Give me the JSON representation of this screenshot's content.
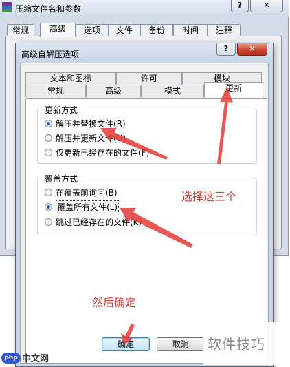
{
  "background_window": {
    "title": "压缩文件名和参数",
    "help_glyph": "?",
    "close_glyph": "✕",
    "tabs": [
      "常规",
      "高级",
      "选项",
      "文件",
      "备份",
      "时间",
      "注释"
    ],
    "selected_tab": "高级"
  },
  "dialog": {
    "title": "高级自解压选项",
    "help_glyph": "?",
    "close_glyph": "✕",
    "tabs_back_row": [
      "文本和图标",
      "许可",
      "模块"
    ],
    "tabs_front_row": [
      "常规",
      "高级",
      "模式",
      "更新"
    ],
    "selected_tab": "更新",
    "update_group": {
      "label": "更新方式",
      "options": [
        "解压并替换文件(R)",
        "解压并更新文件(U)",
        "仅更新已经存在的文件(F)"
      ],
      "selected_index": 0
    },
    "overwrite_group": {
      "label": "覆盖方式",
      "options": [
        "在覆盖前询问(B)",
        "覆盖所有文件(L)",
        "跳过已经存在的文件(K)"
      ],
      "selected_index": 1
    },
    "buttons": {
      "ok": "确定",
      "cancel": "取消"
    }
  },
  "annotations": {
    "select_three": "选择这三个",
    "then_confirm": "然后确定",
    "color": "#e33a36"
  },
  "watermark": {
    "text": "软件技巧",
    "logo": "php",
    "site": "中文网"
  }
}
